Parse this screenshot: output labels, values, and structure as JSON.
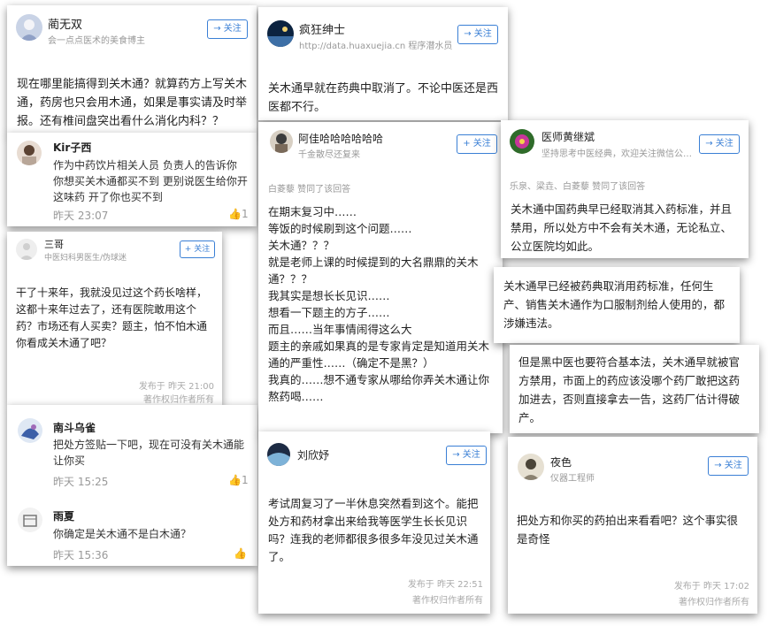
{
  "card1": {
    "name": "蔺无双",
    "bio": "会一点点医术的美食博主",
    "follow": "→ 关注",
    "body": "现在哪里能搞得到关木通？就算药方上写关木通，药房也只会用木通，如果是事实请及时举报。还有椎间盘突出看什么消化内科？？"
  },
  "card2": {
    "name": "疯狂绅士",
    "bio": "http://data.huaxuejia.cn 程序潜水员",
    "follow": "→ 关注",
    "body": "关木通早就在药典中取消了。不论中医还是西医都不行。"
  },
  "card3": {
    "name": "Kir子西",
    "text": "作为中药饮片相关人员 负责人的告诉你 你想买关木通都买不到 更别说医生给你开这味药 开了你也买不到",
    "time": "昨天 23:07",
    "likes": "1"
  },
  "card4": {
    "name": "阿佳哈哈哈哈哈哈",
    "bio": "千金散尽还复来",
    "follow": "+ 关注",
    "liked": "白菱藜 赞同了该回答",
    "body": "在期末复习中……\n等饭的时候刷到这个问题……\n关木通？？？\n就是老师上课的时候提到的大名鼎鼎的关木通？？？\n我其实是想长长见识……\n想看一下题主的方子……\n而且……当年事情闹得这么大\n题主的亲戚如果真的是专家肯定是知道用关木通的严重性……（确定不是黑？）\n我真的……想不通专家从哪给你弄关木通让你熬药喝……"
  },
  "card5": {
    "name": "医师黄继斌",
    "bio": "坚持思考中医经典，欢迎关注微信公…",
    "follow": "→ 关注",
    "liked": "乐泉、梁垚、白菱藜 赞同了该回答",
    "body": "关木通中国药典早已经取消其入药标准，并且禁用，所以处方中不会有关木通，无论私立、公立医院均如此。"
  },
  "card6": {
    "name": "三哥",
    "bio": "中医妇科男医生/伪球迷",
    "follow": "+ 关注",
    "body": "干了十来年，我就没见过这个药长啥样，这都十来年过去了，还有医院敢用这个药？市场还有人买卖？题主，怕不怕木通你看成关木通了吧？",
    "published": "发布于 昨天 21:00",
    "copyright": "著作权归作者所有"
  },
  "card7": {
    "text": "关木通早已经被药典取消用药标准，任何生产、销售关木通作为口服制剂给人使用的，都涉嫌违法。"
  },
  "card8": {
    "text": "但是黑中医也要符合基本法，关木通早就被官方禁用，市面上的药应该没哪个药厂敢把这药加进去，否则直接拿去一告，这药厂估计得破产。"
  },
  "card9": {
    "c1": {
      "name": "南斗乌雀",
      "text": "把处方签贴一下吧，现在可没有关木通能让你买",
      "time": "昨天 15:25",
      "likes": "1"
    },
    "c2": {
      "name": "雨夏",
      "text": "你确定是关木通不是白木通？",
      "time": "昨天 15:36"
    }
  },
  "card10": {
    "name": "刘欣妤",
    "follow": "→ 关注",
    "body": "考试周复习了一半休息突然看到这个。能把处方和药材拿出来给我等医学生长长见识吗？连我的老师都很多很多年没见过关木通了。",
    "published": "发布于 昨天 22:51",
    "copyright": "著作权归作者所有"
  },
  "card11": {
    "name": "夜色",
    "bio": "仪器工程师",
    "follow": "→ 关注",
    "body": "把处方和你买的药拍出来看看吧？这个事实很是奇怪",
    "published": "发布于 昨天 17:02",
    "copyright": "著作权归作者所有"
  }
}
